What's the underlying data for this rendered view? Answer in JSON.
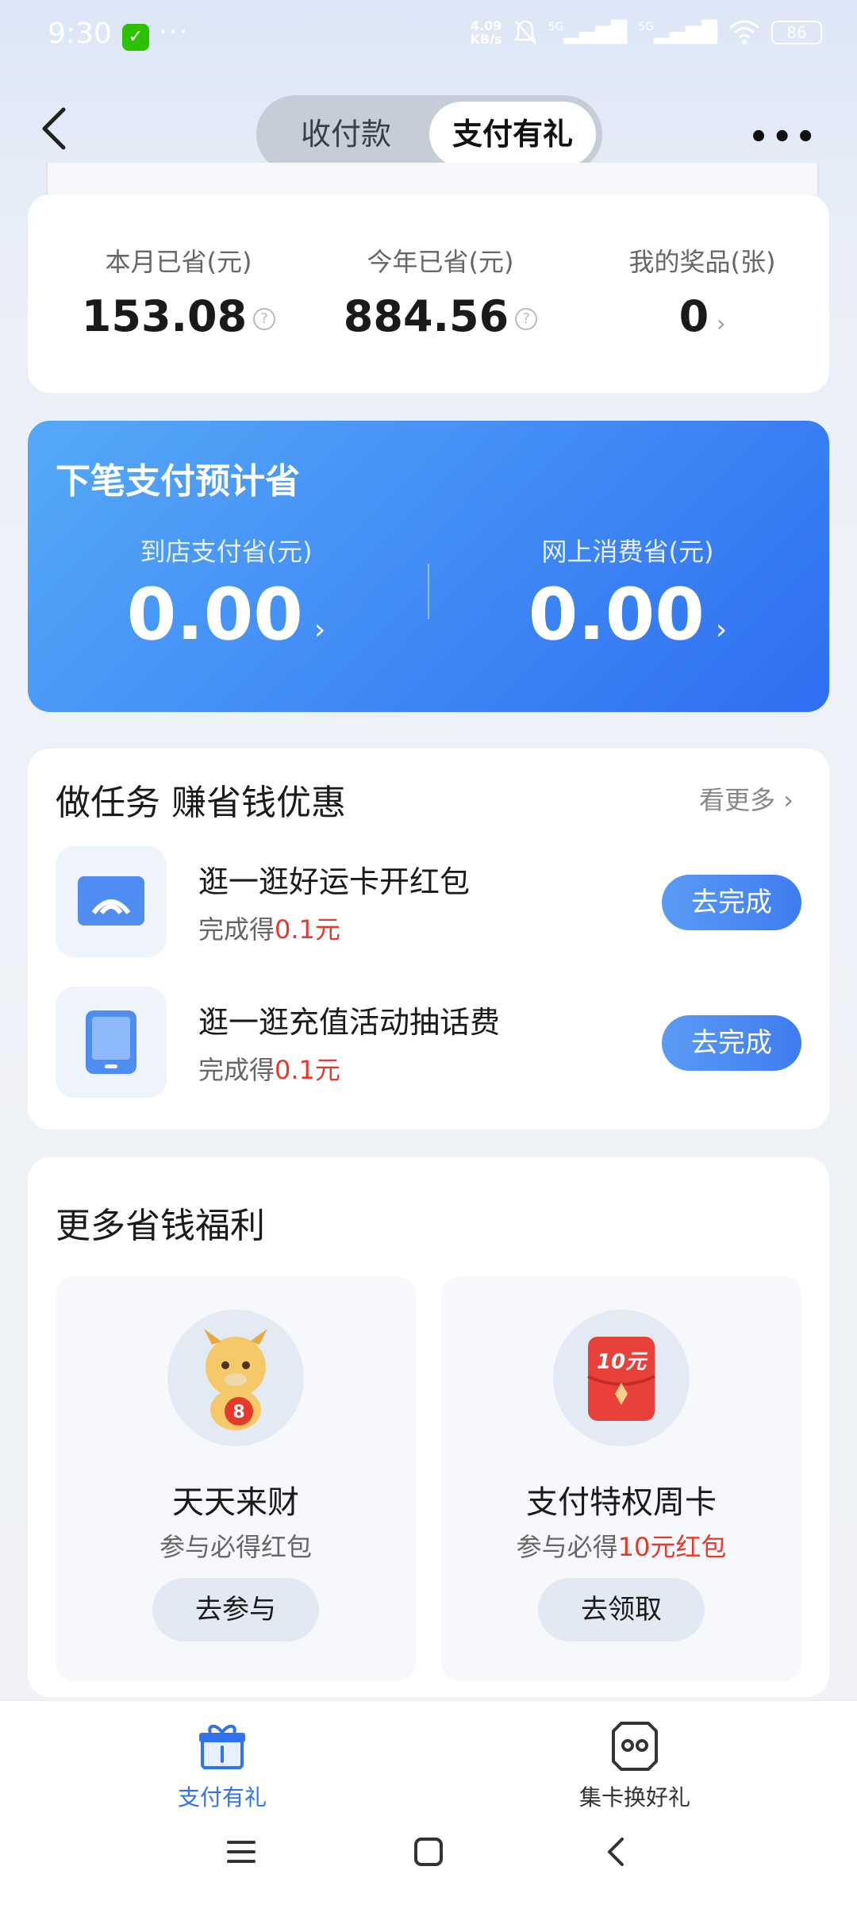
{
  "status_bar": {
    "time": "9:30",
    "dots": "···",
    "net_speed_value": "4.09",
    "net_speed_unit": "KB/s",
    "signal_1": "5G",
    "signal_2": "5G",
    "battery": "86"
  },
  "header": {
    "tabs": [
      {
        "label": "收付款",
        "active": false
      },
      {
        "label": "支付有礼",
        "active": true
      }
    ]
  },
  "savings": {
    "items": [
      {
        "label": "本月已省(元)",
        "value": "153.08"
      },
      {
        "label": "今年已省(元)",
        "value": "884.56"
      },
      {
        "label": "我的奖品(张)",
        "value": "0"
      }
    ]
  },
  "next_payment": {
    "title": "下笔支付预计省",
    "columns": [
      {
        "label": "到店支付省(元)",
        "value": "0.00"
      },
      {
        "label": "网上消费省(元)",
        "value": "0.00"
      }
    ]
  },
  "tasks": {
    "title": "做任务 赚省钱优惠",
    "see_more": "看更多",
    "items": [
      {
        "name": "逛一逛好运卡开红包",
        "reward_prefix": "完成得",
        "reward_value": "0.1元",
        "button": "去完成"
      },
      {
        "name": "逛一逛充值活动抽话费",
        "reward_prefix": "完成得",
        "reward_value": "0.1元",
        "button": "去完成"
      }
    ]
  },
  "benefits": {
    "title": "更多省钱福利",
    "items": [
      {
        "name": "天天来财",
        "sub_prefix": "参与必得红包",
        "sub_highlight": "",
        "button": "去参与",
        "badge_text": "8"
      },
      {
        "name": "支付特权周卡",
        "sub_prefix": "参与必得",
        "sub_highlight": "10元红包",
        "button": "去领取",
        "badge_text": "10元"
      }
    ]
  },
  "tabbar": {
    "tabs": [
      {
        "label": "支付有礼",
        "active": true
      },
      {
        "label": "集卡换好礼",
        "active": false
      }
    ]
  },
  "colors": {
    "accent": "#2f73ef",
    "highlight_red": "#e53a2a",
    "blue_card_start": "#55a9f8",
    "blue_card_end": "#2f6ef2"
  }
}
